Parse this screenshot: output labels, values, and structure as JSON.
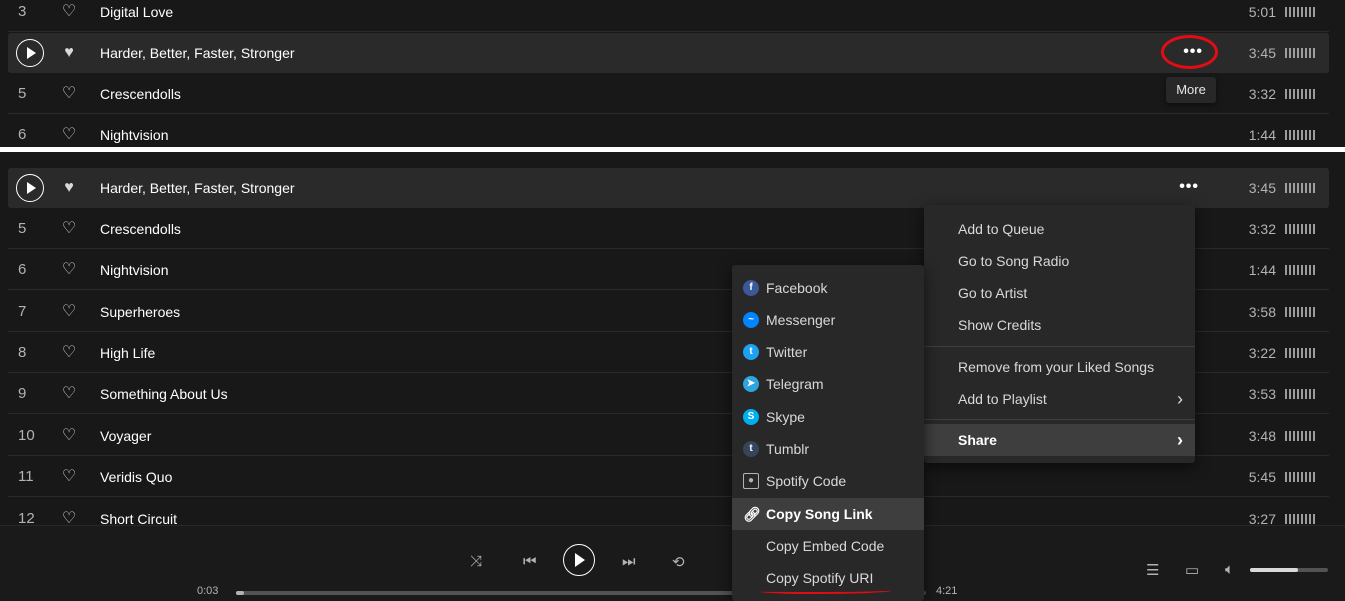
{
  "top_tracks": [
    {
      "num": "3",
      "title": "Digital Love",
      "duration": "5:01"
    },
    {
      "num": "",
      "title": "Harder, Better, Faster, Stronger",
      "duration": "3:45",
      "active": true
    },
    {
      "num": "5",
      "title": "Crescendolls",
      "duration": "3:32"
    },
    {
      "num": "6",
      "title": "Nightvision",
      "duration": "1:44"
    }
  ],
  "more_button": {
    "icon": "ellipsis-icon",
    "symbol": "•••",
    "tooltip": "More"
  },
  "bottom_tracks": [
    {
      "num": "",
      "title": "Harder, Better, Faster, Stronger",
      "duration": "3:45",
      "active": true
    },
    {
      "num": "5",
      "title": "Crescendolls",
      "duration": "3:32"
    },
    {
      "num": "6",
      "title": "Nightvision",
      "duration": "1:44"
    },
    {
      "num": "7",
      "title": "Superheroes",
      "duration": "3:58"
    },
    {
      "num": "8",
      "title": "High Life",
      "duration": "3:22"
    },
    {
      "num": "9",
      "title": "Something About Us",
      "duration": "3:53"
    },
    {
      "num": "10",
      "title": "Voyager",
      "duration": "3:48"
    },
    {
      "num": "11",
      "title": "Veridis Quo",
      "duration": "5:45"
    },
    {
      "num": "12",
      "title": "Short Circuit",
      "duration": "3:27"
    }
  ],
  "context_menu": {
    "add_queue": "Add to Queue",
    "song_radio": "Go to Song Radio",
    "go_artist": "Go to Artist",
    "show_credits": "Show Credits",
    "remove_liked": "Remove from your Liked Songs",
    "add_playlist": "Add to Playlist",
    "share": "Share"
  },
  "share_menu": {
    "facebook": "Facebook",
    "messenger": "Messenger",
    "twitter": "Twitter",
    "telegram": "Telegram",
    "skype": "Skype",
    "tumblr": "Tumblr",
    "spotify_code": "Spotify Code",
    "copy_song_link": "Copy Song Link",
    "copy_embed": "Copy Embed Code",
    "copy_uri": "Copy Spotify URI"
  },
  "player": {
    "elapsed": "0:03",
    "total": "4:21",
    "progress": 0.012,
    "volume": 0.62
  },
  "colors": {
    "annotation": "#e10d16",
    "background": "#181818",
    "highlight": "#3e3e3e"
  }
}
